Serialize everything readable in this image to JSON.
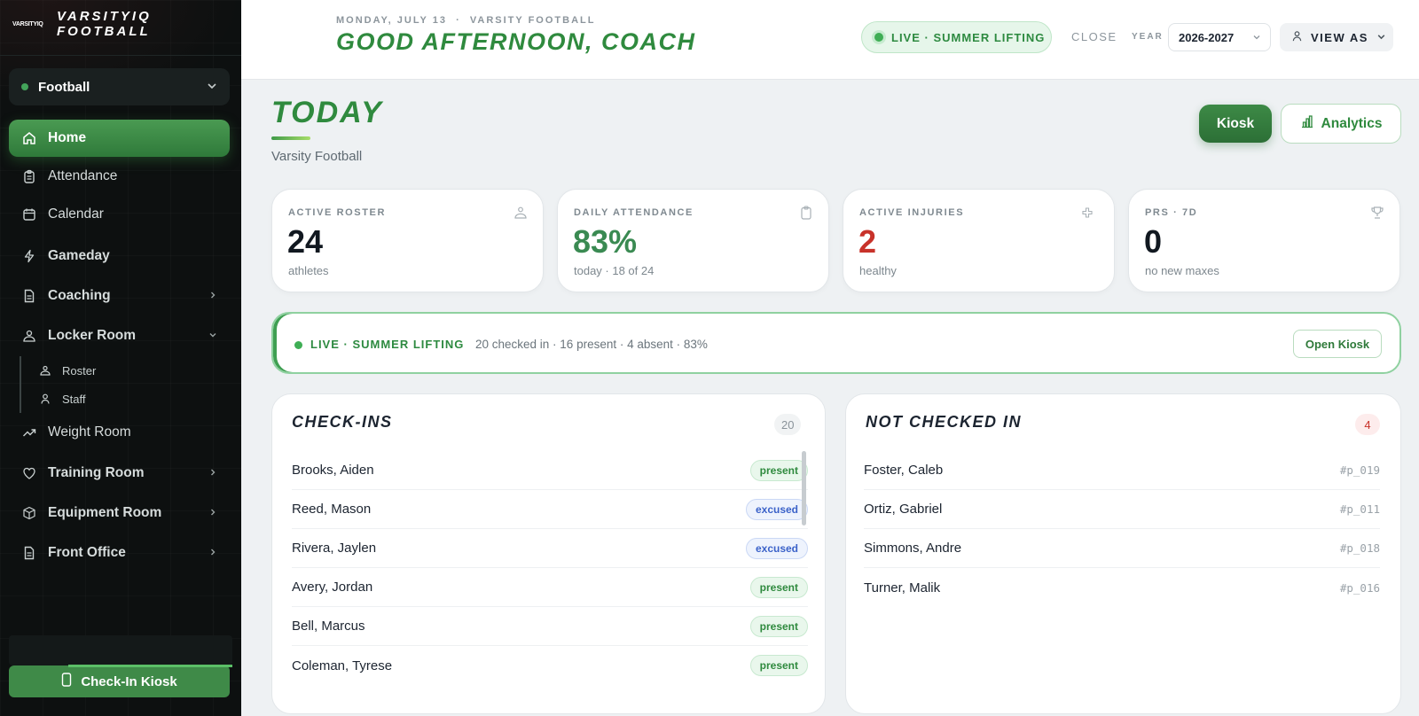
{
  "brand": {
    "mark": "VARSITYIQ",
    "line1": "VARSITYIQ",
    "line2": "FOOTBALL"
  },
  "sport": {
    "selected": "Football"
  },
  "sidebar": {
    "items": [
      {
        "label": "Home",
        "icon": "home-icon"
      },
      {
        "label": "Attendance",
        "icon": "clipboard-icon"
      },
      {
        "label": "Calendar",
        "icon": "calendar-icon"
      },
      {
        "label": "Gameday",
        "icon": "bolt-icon"
      },
      {
        "label": "Coaching",
        "icon": "document-icon"
      },
      {
        "label": "Locker Room",
        "icon": "people-icon"
      },
      {
        "label": "Weight Room",
        "icon": "trend-icon"
      },
      {
        "label": "Training Room",
        "icon": "heart-icon"
      },
      {
        "label": "Equipment Room",
        "icon": "box-icon"
      },
      {
        "label": "Front Office",
        "icon": "file-icon"
      }
    ],
    "sub_items": [
      {
        "label": "Roster",
        "icon": "people-icon"
      },
      {
        "label": "Staff",
        "icon": "person-icon"
      }
    ],
    "kiosk_button": "Check-In Kiosk"
  },
  "header": {
    "date_line": "MONDAY, JULY 13  ·  VARSITY FOOTBALL",
    "greeting": "GOOD AFTERNOON, COACH",
    "live_pill": "LIVE · SUMMER LIFTING",
    "close": "CLOSE",
    "year_label": "YEAR",
    "year_value": "2026-2027",
    "view_as": "VIEW AS"
  },
  "today": {
    "title": "TODAY",
    "subtitle": "Varsity Football",
    "kiosk_button": "Kiosk",
    "analytics_button": "Analytics"
  },
  "stats": [
    {
      "label": "ACTIVE ROSTER",
      "value": "24",
      "sub": "athletes",
      "color": "#111820",
      "icon": "roster-icon"
    },
    {
      "label": "DAILY ATTENDANCE",
      "value": "83%",
      "sub": "today · 18 of 24",
      "color": "#3a8a52",
      "icon": "clipboard-icon"
    },
    {
      "label": "ACTIVE INJURIES",
      "value": "2",
      "sub": "healthy",
      "color": "#c8322a",
      "icon": "medical-cross-icon"
    },
    {
      "label": "PRS · 7D",
      "value": "0",
      "sub": "no new maxes",
      "color": "#111820",
      "icon": "trophy-icon"
    }
  ],
  "banner": {
    "title": "LIVE · SUMMER LIFTING",
    "stats": "20 checked in · 16 present · 4 absent · 83%",
    "open_button": "Open Kiosk"
  },
  "checkins": {
    "title": "CHECK-INS",
    "count": "20",
    "rows": [
      {
        "name": "Brooks, Aiden",
        "status": "present"
      },
      {
        "name": "Reed, Mason",
        "status": "excused"
      },
      {
        "name": "Rivera, Jaylen",
        "status": "excused"
      },
      {
        "name": "Avery, Jordan",
        "status": "present"
      },
      {
        "name": "Bell, Marcus",
        "status": "present"
      },
      {
        "name": "Coleman, Tyrese",
        "status": "present"
      }
    ]
  },
  "not_checked_in": {
    "title": "NOT CHECKED IN",
    "count": "4",
    "rows": [
      {
        "name": "Foster, Caleb",
        "id": "#p_019"
      },
      {
        "name": "Ortiz, Gabriel",
        "id": "#p_011"
      },
      {
        "name": "Simmons, Andre",
        "id": "#p_018"
      },
      {
        "name": "Turner, Malik",
        "id": "#p_016"
      }
    ]
  },
  "colors": {
    "accent": "#2f8a3e",
    "danger": "#c8322a",
    "sidebar_bg": "#0d1010"
  }
}
